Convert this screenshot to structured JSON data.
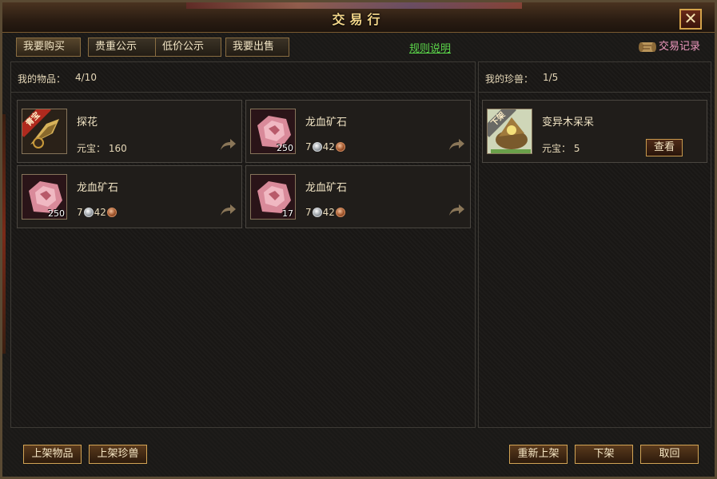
{
  "window": {
    "title": "交易行",
    "close_label": "✕"
  },
  "tabs": [
    {
      "label": "我要购买"
    },
    {
      "label": "贵重公示"
    },
    {
      "label": "低价公示"
    },
    {
      "label": "我要出售"
    }
  ],
  "rules_link": "规则说明",
  "history_label": "交易记录",
  "items_panel": {
    "label": "我的物品：",
    "count": "4/10"
  },
  "items": [
    {
      "name": "探花",
      "price_label": "元宝：",
      "price_value": "160",
      "ribbon": "青宝",
      "qty": "",
      "icon": "flower-item-icon"
    },
    {
      "name": "龙血矿石",
      "silver": "7",
      "copper": "42",
      "qty": "250",
      "icon": "ore-icon"
    },
    {
      "name": "龙血矿石",
      "silver": "7",
      "copper": "42",
      "qty": "250",
      "icon": "ore-icon"
    },
    {
      "name": "龙血矿石",
      "silver": "7",
      "copper": "42",
      "qty": "17",
      "icon": "ore-icon"
    }
  ],
  "pets_panel": {
    "label": "我的珍兽：",
    "count": "1/5"
  },
  "pets": [
    {
      "name": "变异木呆呆",
      "price_label": "元宝：",
      "price_value": "5",
      "ribbon": "下架",
      "view_label": "查看",
      "icon": "pet-icon"
    }
  ],
  "bottom_buttons": {
    "list_item": "上架物品",
    "list_pet": "上架珍兽",
    "relist": "重新上架",
    "delist": "下架",
    "cancel": "取回"
  },
  "colors": {
    "rules_link": "#5bd64a",
    "history": "#f09ac0",
    "button_border": "#d2a455"
  }
}
